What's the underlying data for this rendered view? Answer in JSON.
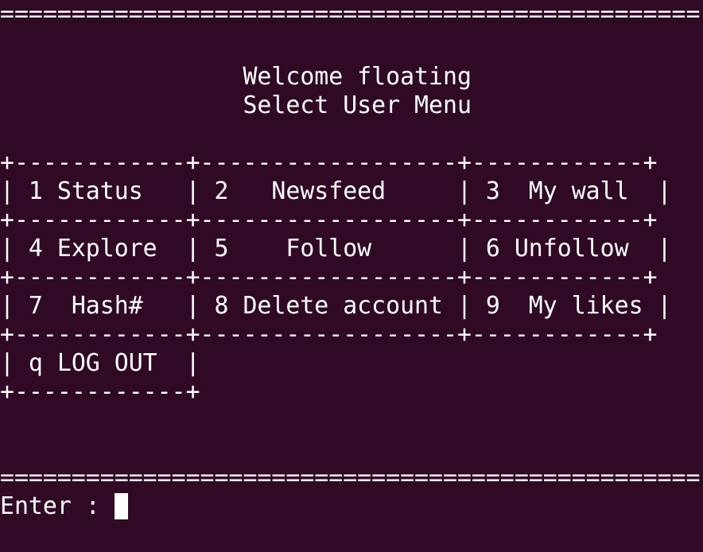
{
  "terminal": {
    "background": "#300a24",
    "foreground": "#ffffff",
    "separator_top": "=================================================",
    "welcome": "                 Welcome floating",
    "menu_title": "                 Select User Menu",
    "table": {
      "border_top": "+------------+------------------+------------+",
      "row1": "| 1 Status   | 2   Newsfeed     | 3  My wall  |",
      "border_1": "+------------+------------------+------------+",
      "row2": "| 4 Explore  | 5    Follow      | 6 Unfollow  |",
      "border_2": "+------------+------------------+------------+",
      "row3": "| 7  Hash#   | 8 Delete account | 9  My likes |",
      "border_3": "+------------+------------------+------------+",
      "row4": "| q LOG OUT  |",
      "border_bottom": "+------------+"
    },
    "separator_bottom": "=================================================",
    "prompt": "Enter : "
  }
}
